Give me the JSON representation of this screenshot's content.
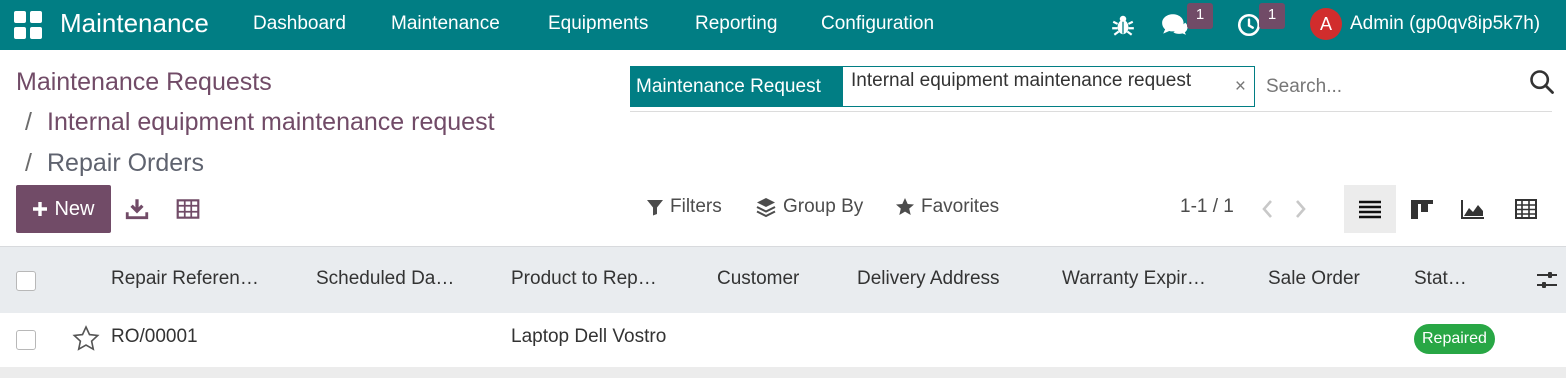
{
  "navbar": {
    "app_name": "Maintenance",
    "menus": [
      "Dashboard",
      "Maintenance",
      "Equipments",
      "Reporting",
      "Configuration"
    ],
    "messages_count": "1",
    "activities_count": "1",
    "user_initial": "A",
    "user_name": "Admin (gp0qv8ip5k7h)",
    "color": "#017e84"
  },
  "breadcrumb": {
    "item1": "Maintenance Requests",
    "item2": "Internal equipment maintenance request",
    "current": "Repair Orders",
    "separator": "/"
  },
  "search": {
    "facet_name": "Maintenance Request",
    "facet_value": "Internal equipment maintenance request",
    "facet_close": "×",
    "placeholder": "Search..."
  },
  "toolbar": {
    "new_label": "New",
    "filters_label": "Filters",
    "group_by_label": "Group By",
    "favorites_label": "Favorites",
    "pager": "1-1 / 1"
  },
  "table": {
    "columns": [
      "Repair Referen…",
      "Scheduled Da…",
      "Product to Rep…",
      "Customer",
      "Delivery Address",
      "Warranty Expir…",
      "Sale Order",
      "Stat…"
    ],
    "rows": [
      {
        "reference": "RO/00001",
        "scheduled_date": "",
        "product": "Laptop Dell Vostro",
        "customer": "",
        "delivery_address": "",
        "warranty": "",
        "sale_order": "",
        "status": "Repaired"
      }
    ]
  },
  "colors": {
    "primary": "#714b67",
    "teal": "#017e84",
    "status_repaired": "#28a745"
  }
}
